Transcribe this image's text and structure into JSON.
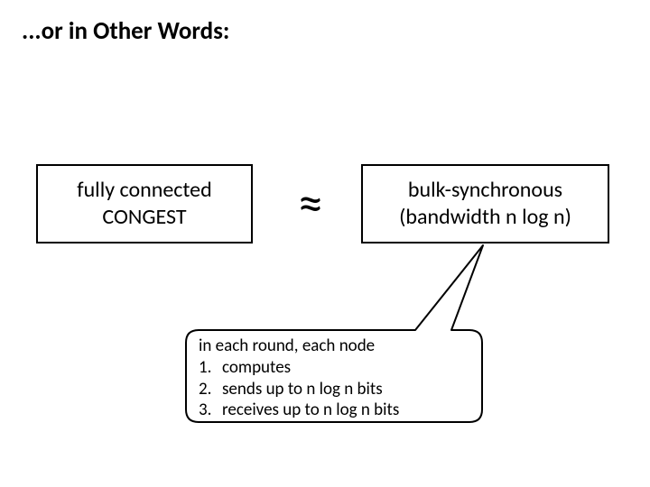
{
  "title": "...or in Other Words:",
  "leftBox": {
    "line1": "fully connected",
    "line2": "CONGEST"
  },
  "approxSymbol": "≈",
  "rightBox": {
    "line1": "bulk-synchronous",
    "line2": "(bandwidth n log n)"
  },
  "callout": {
    "intro": "in each round, each node",
    "items": [
      {
        "num": "1.",
        "text": "computes"
      },
      {
        "num": "2.",
        "text": "sends up to n log n bits"
      },
      {
        "num": "3.",
        "text": "receives up to n log n bits"
      }
    ]
  }
}
